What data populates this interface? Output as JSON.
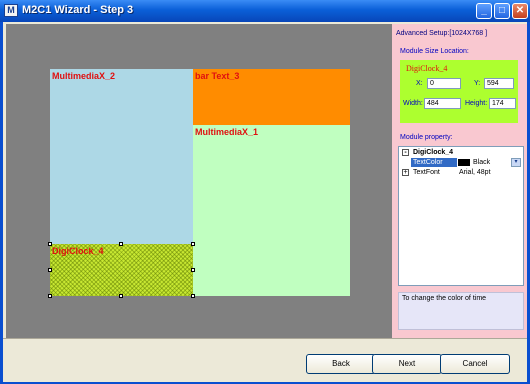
{
  "window": {
    "title": "M2C1 Wizard - Step 3",
    "minimize": "_",
    "maximize": "□",
    "close": "✕"
  },
  "modules": {
    "multimedia2": "MultimediaX_2",
    "bar_text": "bar Text_3",
    "multimedia1": "MultimediaX_1",
    "digiclock": "DigiClock_4"
  },
  "panel": {
    "advanced_setup": "Advanced Setup:[1024X768 ]",
    "size_location_label": "Module Size Location:",
    "module_name": "DigiClock_4",
    "x_label": "X:",
    "x_value": "0",
    "y_label": "Y:",
    "y_value": "594",
    "width_label": "Width:",
    "width_value": "484",
    "height_label": "Height:",
    "height_value": "174",
    "property_label": "Module property:",
    "grid": {
      "group": "DigiClock_4",
      "rows": [
        {
          "name": "TextColor",
          "value": "Black",
          "swatch": "#000000"
        },
        {
          "name": "TextFont",
          "value": "Arial, 48pt"
        }
      ]
    },
    "description": "To change the color of time"
  },
  "buttons": {
    "back": "Back",
    "next": "Next",
    "cancel": "Cancel"
  },
  "colors": {
    "accent": "#0a5fd8",
    "selection": "#316ac5",
    "module_label": "#e01010"
  }
}
